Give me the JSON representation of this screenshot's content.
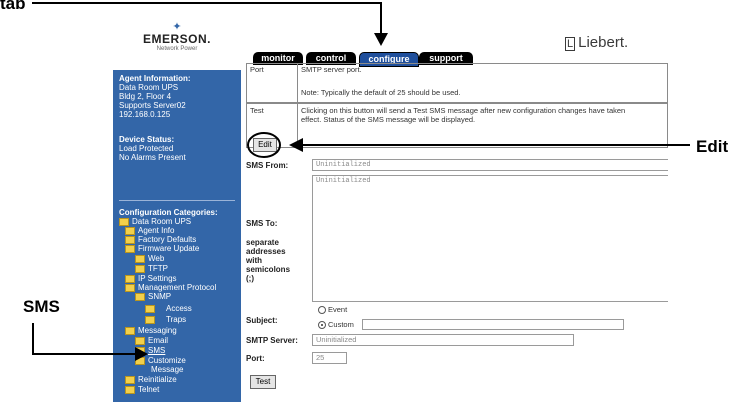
{
  "callouts": {
    "tab": "tab",
    "edit": "Edit",
    "sms": "SMS"
  },
  "header": {
    "emerson_logo": "EMERSON.",
    "emerson_sub": "Network Power",
    "liebert_logo": "Liebert."
  },
  "tabs": [
    {
      "label": "monitor"
    },
    {
      "label": "control"
    },
    {
      "label": "configure"
    },
    {
      "label": "support"
    }
  ],
  "sidebar": {
    "agent_heading": "Agent Information:",
    "agent_lines": [
      "Data Room UPS",
      "Bldg 2, Floor 4",
      "Supports Server02",
      "192.168.0.125"
    ],
    "device_heading": "Device Status:",
    "device_lines": [
      "Load Protected",
      "No Alarms Present"
    ],
    "config_heading": "Configuration Categories:",
    "tree": [
      "Data Room UPS",
      "Agent Info",
      "Factory Defaults",
      "Firmware Update",
      "Web",
      "TFTP",
      "IP Settings",
      "Management Protocol",
      "SNMP",
      "Access",
      "Traps",
      "Messaging",
      "Email",
      "SMS",
      "Customize",
      "Message",
      "Reinitialize",
      "Telnet"
    ]
  },
  "help_table": {
    "row1_label": "Port",
    "row1_text1": "SMTP server port.",
    "row1_text2": "Note: Typically the default of 25 should be used.",
    "row2_label": "Test",
    "row2_text1": "Clicking on this button will send a Test SMS message after new configuration changes have taken",
    "row2_text2": "effect. Status of the SMS message will be displayed."
  },
  "form": {
    "edit_button": "Edit",
    "sms_from_label": "SMS From:",
    "sms_from_value": "Uninitialized",
    "sms_to_label": "SMS To:",
    "sms_to_value": "Uninitialized",
    "sms_to_hint": [
      "separate",
      "addresses",
      "with",
      "semicolons",
      "(;)"
    ],
    "subject_label": "Subject:",
    "subject_event": "Event",
    "subject_custom": "Custom",
    "smtp_label": "SMTP Server:",
    "smtp_value": "Uninitialized",
    "port_label": "Port:",
    "port_value": "25",
    "test_button": "Test"
  }
}
